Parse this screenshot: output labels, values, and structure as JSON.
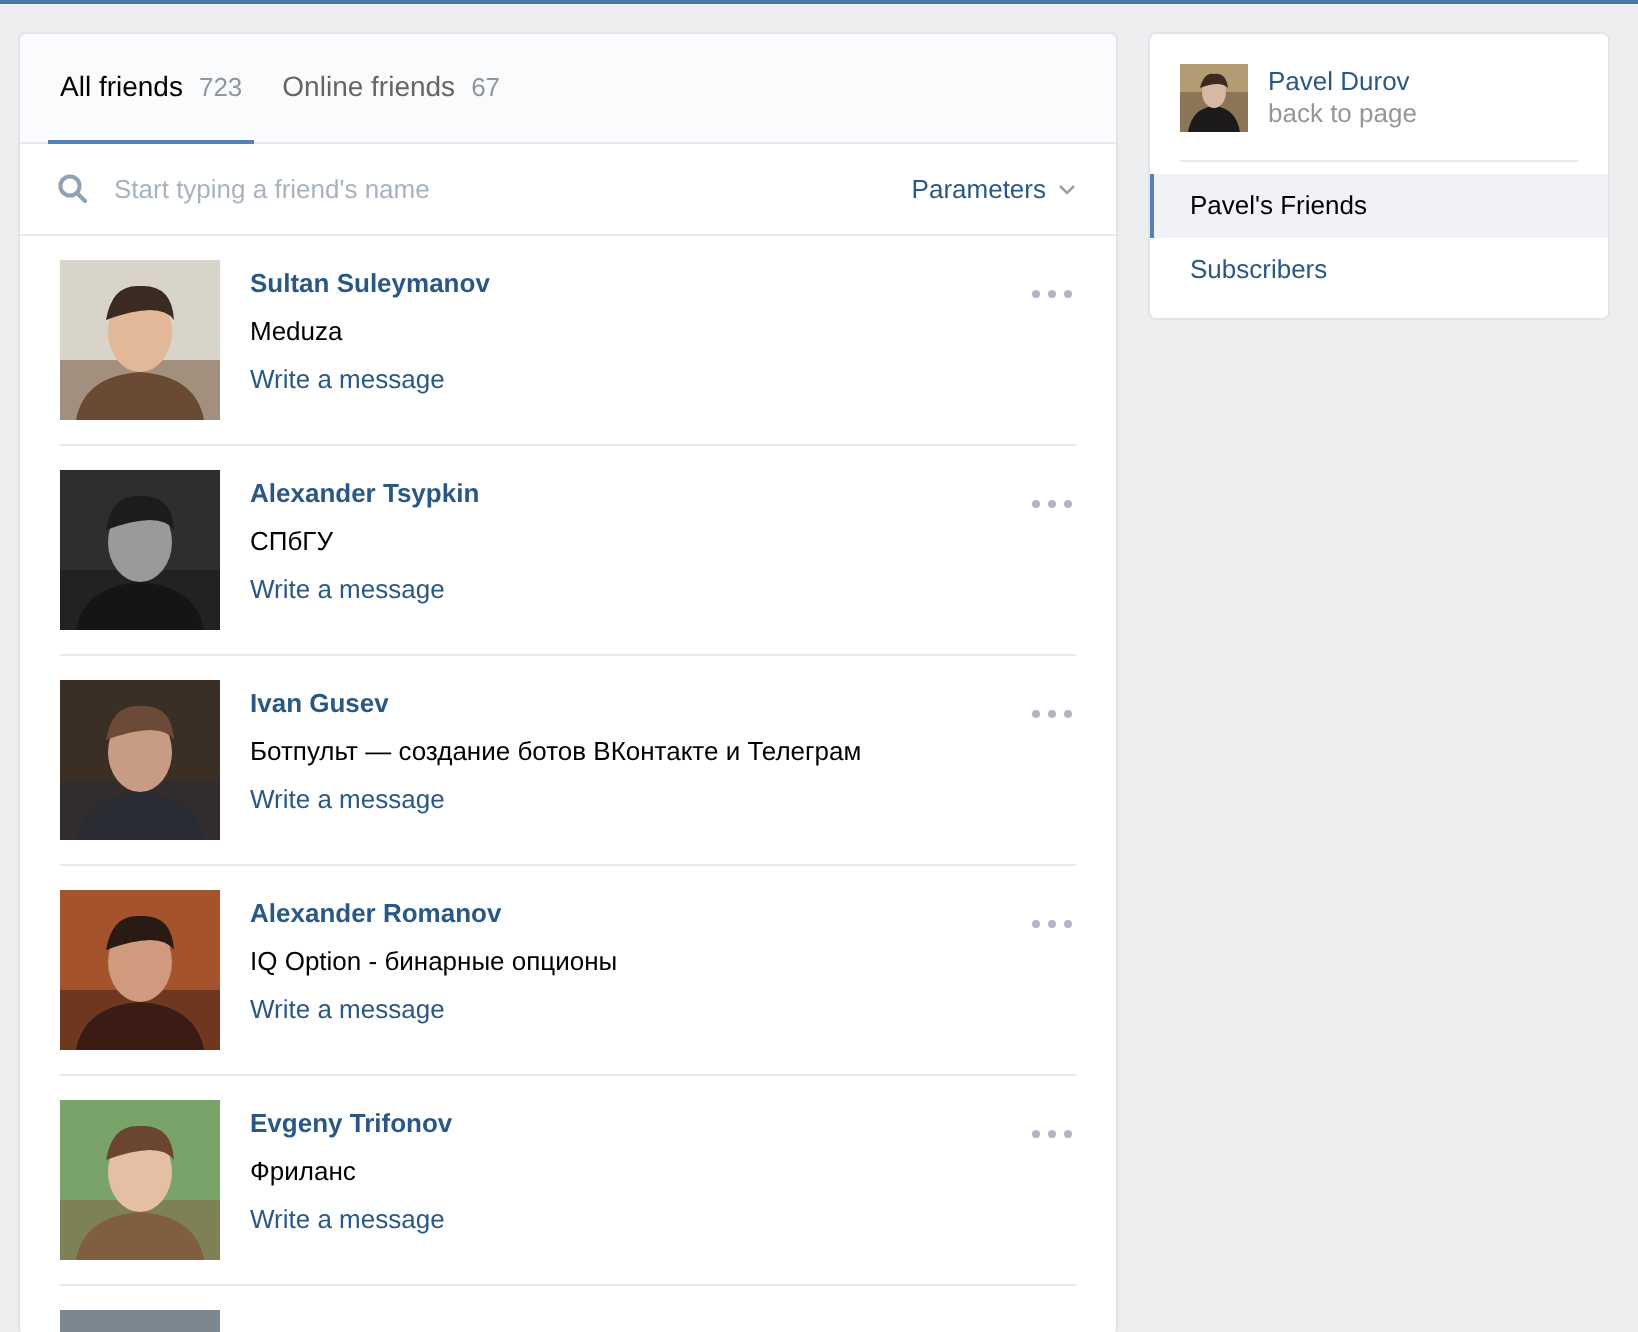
{
  "tabs": [
    {
      "label": "All friends",
      "count": "723",
      "selected": true
    },
    {
      "label": "Online friends",
      "count": "67",
      "selected": false
    }
  ],
  "search": {
    "placeholder": "Start typing a friend's name"
  },
  "parameters_button": {
    "label": "Parameters"
  },
  "friends": [
    {
      "kind": "friend",
      "name": "Sultan Suleymanov",
      "info": "Meduza",
      "action": "Write a message"
    },
    {
      "kind": "friend",
      "name": "Alexander Tsypkin",
      "info": "СПбГУ",
      "action": "Write a message"
    },
    {
      "kind": "friend",
      "name": "Ivan Gusev",
      "info": "Ботпульт — создание ботов ВКонтакте и Телеграм",
      "action": "Write a message"
    },
    {
      "kind": "friend",
      "name": "Alexander Romanov",
      "info": "IQ Option - бинарные опционы",
      "action": "Write a message"
    },
    {
      "kind": "friend",
      "name": "Evgeny Trifonov",
      "info": "Фриланс",
      "action": "Write a message"
    },
    {
      "kind": "picture"
    }
  ],
  "profile": {
    "name": "Pavel Durov",
    "link": "back to page"
  },
  "side_menu": [
    {
      "label": "Pavel's Friends",
      "selected": true
    },
    {
      "label": "Subscribers",
      "selected": false
    }
  ]
}
